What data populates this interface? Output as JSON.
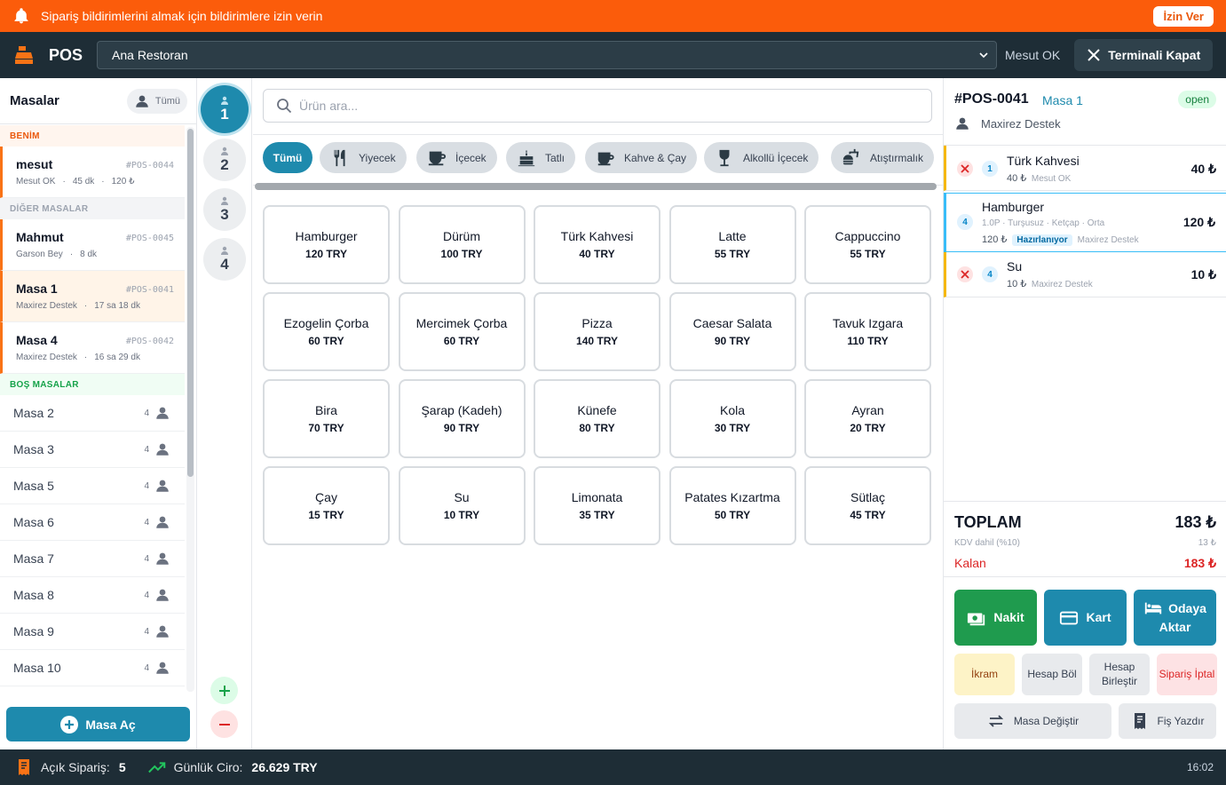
{
  "notification": {
    "text": "Sipariş bildirimlerini almak için bildirimlere izin verin",
    "allow_label": "İzin Ver"
  },
  "header": {
    "app_name": "POS",
    "branch": "Ana Restoran",
    "user": "Mesut OK",
    "close_label": "Terminali Kapat"
  },
  "tables_panel": {
    "title": "Masalar",
    "filter_label": "Tümü",
    "section_mine": "BENİM",
    "section_other": "DİĞER MASALAR",
    "section_empty": "BOŞ MASALAR",
    "mine": [
      {
        "name": "mesut",
        "code": "#POS-0044",
        "waiter": "Mesut OK",
        "time": "45 dk",
        "amount": "120 ₺"
      }
    ],
    "other": [
      {
        "name": "Mahmut",
        "code": "#POS-0045",
        "waiter": "Garson Bey",
        "time": "8 dk"
      },
      {
        "name": "Masa 1",
        "code": "#POS-0041",
        "waiter": "Maxirez Destek",
        "time": "17 sa 18 dk"
      },
      {
        "name": "Masa 4",
        "code": "#POS-0042",
        "waiter": "Maxirez Destek",
        "time": "16 sa 29 dk"
      }
    ],
    "empty": [
      {
        "name": "Masa 2",
        "capacity": "4"
      },
      {
        "name": "Masa 3",
        "capacity": "4"
      },
      {
        "name": "Masa 5",
        "capacity": "4"
      },
      {
        "name": "Masa 6",
        "capacity": "4"
      },
      {
        "name": "Masa 7",
        "capacity": "4"
      },
      {
        "name": "Masa 8",
        "capacity": "4"
      },
      {
        "name": "Masa 9",
        "capacity": "4"
      },
      {
        "name": "Masa 10",
        "capacity": "4"
      }
    ],
    "open_table_label": "Masa Aç"
  },
  "guests": [
    "1",
    "2",
    "3",
    "4"
  ],
  "products_panel": {
    "search_placeholder": "Ürün ara...",
    "categories": [
      "Tümü",
      "Yiyecek",
      "İçecek",
      "Tatlı",
      "Kahve & Çay",
      "Alkollü İçecek",
      "Atıştırmalık"
    ],
    "items": [
      {
        "name": "Hamburger",
        "price": "120 TRY"
      },
      {
        "name": "Dürüm",
        "price": "100 TRY"
      },
      {
        "name": "Türk Kahvesi",
        "price": "40 TRY"
      },
      {
        "name": "Latte",
        "price": "55 TRY"
      },
      {
        "name": "Cappuccino",
        "price": "55 TRY"
      },
      {
        "name": "Ezogelin Çorba",
        "price": "60 TRY"
      },
      {
        "name": "Mercimek Çorba",
        "price": "60 TRY"
      },
      {
        "name": "Pizza",
        "price": "140 TRY"
      },
      {
        "name": "Caesar Salata",
        "price": "90 TRY"
      },
      {
        "name": "Tavuk Izgara",
        "price": "110 TRY"
      },
      {
        "name": "Bira",
        "price": "70 TRY"
      },
      {
        "name": "Şarap (Kadeh)",
        "price": "90 TRY"
      },
      {
        "name": "Künefe",
        "price": "80 TRY"
      },
      {
        "name": "Kola",
        "price": "30 TRY"
      },
      {
        "name": "Ayran",
        "price": "20 TRY"
      },
      {
        "name": "Çay",
        "price": "15 TRY"
      },
      {
        "name": "Su",
        "price": "10 TRY"
      },
      {
        "name": "Limonata",
        "price": "35 TRY"
      },
      {
        "name": "Patates Kızartma",
        "price": "50 TRY"
      },
      {
        "name": "Sütlaç",
        "price": "45 TRY"
      }
    ]
  },
  "order": {
    "id": "#POS-0041",
    "table": "Masa 1",
    "status": "open",
    "waiter": "Maxirez Destek",
    "items": [
      {
        "qty": "1",
        "name": "Türk Kahvesi",
        "unit": "40 ₺",
        "by": "Mesut OK",
        "price": "40 ₺"
      },
      {
        "qty": "4",
        "name": "Hamburger",
        "options": "1.0P · Turşusuz · Ketçap · Orta",
        "unit": "120 ₺",
        "state": "Hazırlanıyor",
        "by": "Maxirez Destek",
        "price": "120 ₺"
      },
      {
        "qty": "4",
        "name": "Su",
        "unit": "10 ₺",
        "by": "Maxirez Destek",
        "price": "10 ₺"
      }
    ],
    "total_label": "TOPLAM",
    "total": "183 ₺",
    "vat_label": "KDV dahil (%10)",
    "vat": "13 ₺",
    "remaining_label": "Kalan",
    "remaining": "183 ₺",
    "pay_cash": "Nakit",
    "pay_card": "Kart",
    "pay_room_1": "Odaya",
    "pay_room_2": "Aktar",
    "complimentary": "İkram",
    "split_bill": "Hesap Böl",
    "merge_bill_1": "Hesap",
    "merge_bill_2": "Birleştir",
    "cancel_order": "Sipariş İptal",
    "change_table": "Masa Değiştir",
    "print_receipt": "Fiş Yazdır"
  },
  "status_bar": {
    "open_orders_label": "Açık Sipariş:",
    "open_orders": "5",
    "revenue_label": "Günlük Ciro:",
    "revenue": "26.629 TRY",
    "time": "16:02"
  },
  "colors": {
    "accent": "#1e8aad",
    "alert": "#fb5c0b",
    "dark": "#1e2d36",
    "success": "#1f9b4e",
    "danger": "#dc2626"
  }
}
